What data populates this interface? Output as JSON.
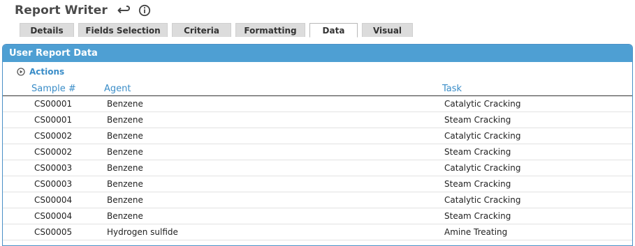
{
  "header": {
    "title": "Report Writer",
    "icons": [
      "undo-icon",
      "info-icon"
    ]
  },
  "tabs": [
    {
      "label": "Details",
      "active": false
    },
    {
      "label": "Fields Selection",
      "active": false
    },
    {
      "label": "Criteria",
      "active": false
    },
    {
      "label": "Formatting",
      "active": false
    },
    {
      "label": "Data",
      "active": true
    },
    {
      "label": "Visual",
      "active": false
    }
  ],
  "panel": {
    "title": "User Report Data",
    "actions_label": "Actions",
    "columns": [
      "Sample #",
      "Agent",
      "Task"
    ],
    "rows": [
      [
        "CS00001",
        "Benzene",
        "Catalytic Cracking"
      ],
      [
        "CS00001",
        "Benzene",
        "Steam Cracking"
      ],
      [
        "CS00002",
        "Benzene",
        "Catalytic Cracking"
      ],
      [
        "CS00002",
        "Benzene",
        "Steam Cracking"
      ],
      [
        "CS00003",
        "Benzene",
        "Catalytic Cracking"
      ],
      [
        "CS00003",
        "Benzene",
        "Steam Cracking"
      ],
      [
        "CS00004",
        "Benzene",
        "Catalytic Cracking"
      ],
      [
        "CS00004",
        "Benzene",
        "Steam Cracking"
      ],
      [
        "CS00005",
        "Hydrogen sulfide",
        "Amine Treating"
      ]
    ]
  },
  "colors": {
    "panel_header": "#4e9fd3",
    "link": "#3a8dc8",
    "tab_bg": "#dcdcdc"
  }
}
